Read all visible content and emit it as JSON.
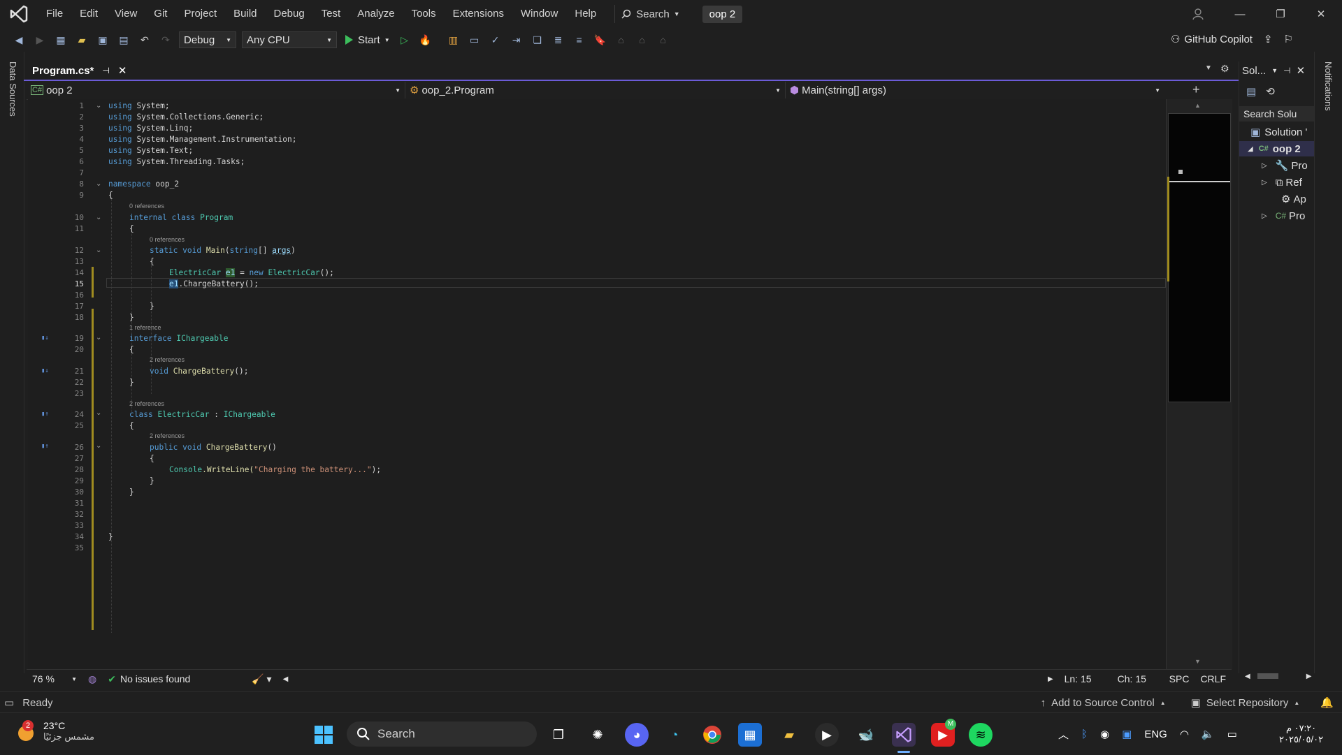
{
  "menu": [
    "File",
    "Edit",
    "View",
    "Git",
    "Project",
    "Build",
    "Debug",
    "Test",
    "Analyze",
    "Tools",
    "Extensions",
    "Window",
    "Help"
  ],
  "search_label": "Search",
  "solution_name": "oop 2",
  "toolbar": {
    "config": "Debug",
    "platform": "Any CPU",
    "start_label": "Start",
    "copilot_label": "GitHub Copilot"
  },
  "left_strip_label": "Data Sources",
  "right_strip_label": "Notifications",
  "tab": {
    "title": "Program.cs*"
  },
  "navbar": {
    "project": "oop 2",
    "type": "oop_2.Program",
    "member": "Main(string[] args)"
  },
  "editor": {
    "line_numbers": [
      "1",
      "2",
      "3",
      "4",
      "5",
      "6",
      "7",
      "8",
      "9",
      "10",
      "11",
      "12",
      "13",
      "14",
      "15",
      "16",
      "17",
      "18",
      "19",
      "20",
      "21",
      "22",
      "23",
      "24",
      "25",
      "26",
      "27",
      "28",
      "29",
      "30",
      "31",
      "32",
      "33",
      "34",
      "35"
    ],
    "current_line": 15,
    "hints": {
      "h10": "0 references",
      "h12": "0 references",
      "h19": "1 reference",
      "h21": "2 references",
      "h24": "2 references",
      "h26": "2 references"
    },
    "tokens": {
      "using": "using",
      "sys": "System;",
      "sys_coll": "System.Collections.Generic;",
      "sys_linq": "System.Linq;",
      "sys_mgmt": "System.Management.Instrumentation;",
      "sys_text": "System.Text;",
      "sys_tasks": "System.Threading.Tasks;",
      "namespace": "namespace",
      "ns_name": "oop_2",
      "open": "{",
      "close": "}",
      "internal": "internal",
      "class": "class",
      "program": "Program",
      "static": "static",
      "void": "void",
      "main": "Main",
      "paren_open": "(",
      "string": "string",
      "brackets": "[] ",
      "args": "args",
      "paren_close": ")",
      "electric_car": "ElectricCar",
      "e1": "e1",
      "eq": " = ",
      "new": "new",
      "call_end": "();",
      "charge_call": ".ChargeBattery();",
      "interface": "interface",
      "ichargeable": "IChargeable",
      "charge_battery": "ChargeBattery",
      "decl_end": "();",
      "colon": " : ",
      "public": "public",
      "method_parens": "()",
      "console": "Console",
      "writeline": ".WriteLine(",
      "msg": "\"Charging the battery...\"",
      "stmt_end": ");"
    }
  },
  "solution_explorer": {
    "title": "Sol...",
    "search": "Search Solu",
    "items": [
      "Solution '",
      "oop 2",
      "Pro",
      "Ref",
      "Ap",
      "Pro"
    ]
  },
  "editor_status": {
    "zoom": "76 %",
    "issues": "No issues found",
    "ln": "Ln: 15",
    "ch": "Ch: 15",
    "spc": "SPC",
    "crlf": "CRLF"
  },
  "status": {
    "ready": "Ready",
    "source_control": "Add to Source Control",
    "repository": "Select Repository"
  },
  "taskbar": {
    "weather_temp": "23°C",
    "weather_desc": "مشمس جزئيًا",
    "weather_badge": "2",
    "search": "Search",
    "lang": "ENG",
    "time": "٠٧:٢٠ م",
    "date": "٢٠٢٥/٠٥/٠٢",
    "meet_badge": "M"
  },
  "colors": {
    "accent": "#6b5bd6",
    "keyword": "#569cd6",
    "type": "#4ec9b0",
    "string": "#ce9178",
    "change_bar": "#a08c20"
  }
}
